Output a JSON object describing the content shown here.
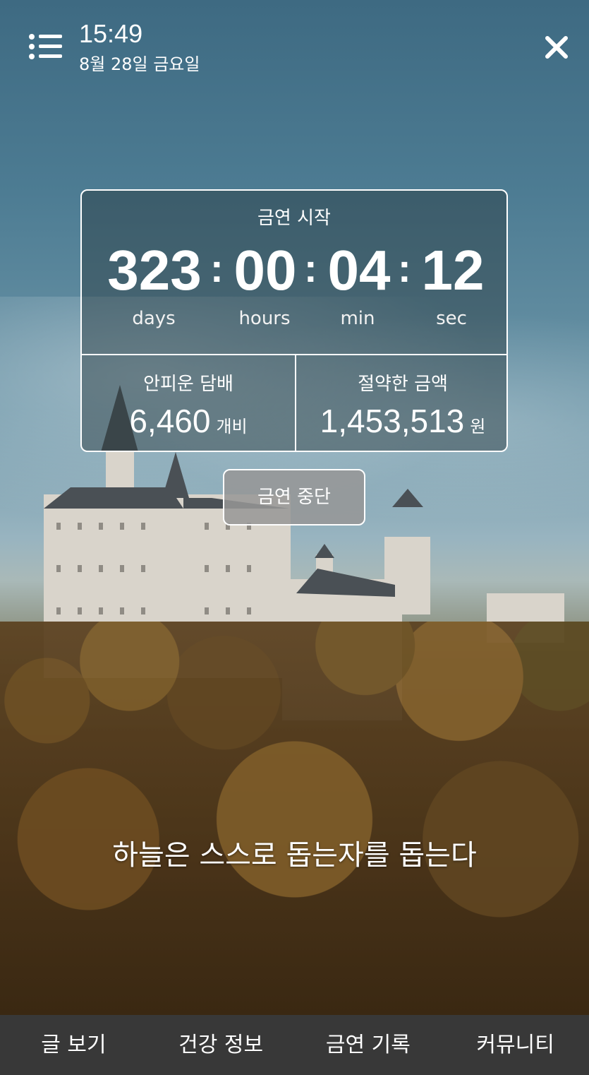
{
  "header": {
    "time": "15:49",
    "date": "8월 28일 금요일"
  },
  "timer": {
    "title": "금연 시작",
    "days": "323",
    "hours": "00",
    "min": "04",
    "sec": "12",
    "separator": ":",
    "labels": {
      "days": "days",
      "hours": "hours",
      "min": "min",
      "sec": "sec"
    }
  },
  "stats": {
    "cigarettes": {
      "label": "안피운 담배",
      "value": "6,460",
      "unit": "개비"
    },
    "savings": {
      "label": "절약한 금액",
      "value": "1,453,513",
      "unit": "원"
    }
  },
  "stop_button": "금연 중단",
  "quote": "하늘은 스스로 돕는자를 돕는다",
  "nav": {
    "items": [
      {
        "label": "글 보기"
      },
      {
        "label": "건강 정보"
      },
      {
        "label": "금연 기록"
      },
      {
        "label": "커뮤니티"
      }
    ]
  },
  "icons": {
    "menu": "list-menu-icon",
    "close": "close-icon"
  },
  "colors": {
    "nav_bg": "#383838",
    "card_border": "#ffffff"
  }
}
